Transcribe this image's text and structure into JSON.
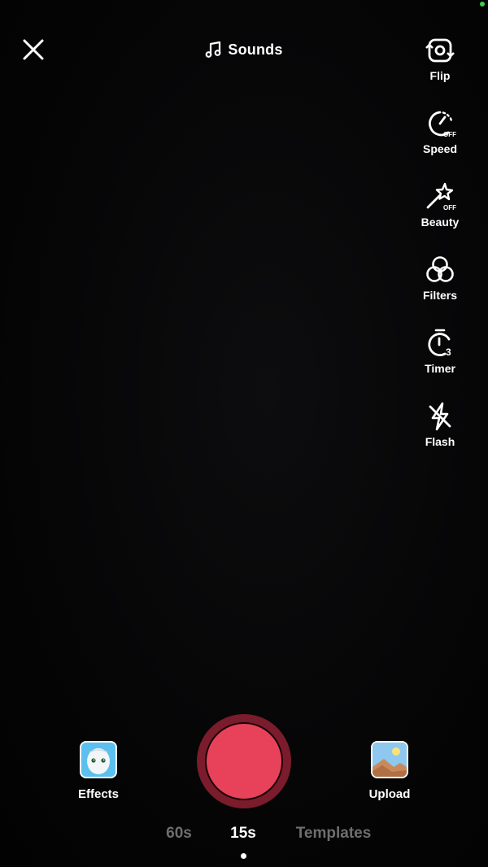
{
  "top_bar": {
    "sounds_label": "Sounds"
  },
  "side_tools": [
    {
      "id": "flip",
      "label": "Flip",
      "icon": "flip-camera-icon"
    },
    {
      "id": "speed",
      "label": "Speed",
      "icon": "speed-icon",
      "badge": "OFF"
    },
    {
      "id": "beauty",
      "label": "Beauty",
      "icon": "beauty-wand-icon",
      "badge": "OFF"
    },
    {
      "id": "filters",
      "label": "Filters",
      "icon": "filters-icon"
    },
    {
      "id": "timer",
      "label": "Timer",
      "icon": "timer-icon",
      "badge": "3"
    },
    {
      "id": "flash",
      "label": "Flash",
      "icon": "flash-off-icon"
    }
  ],
  "bottom": {
    "effects_label": "Effects",
    "upload_label": "Upload"
  },
  "modes": [
    {
      "label": "60s",
      "active": false
    },
    {
      "label": "15s",
      "active": true
    },
    {
      "label": "Templates",
      "active": false
    }
  ],
  "colors": {
    "record_outer": "#7a1c2b",
    "record_inner": "#e8425a",
    "status_dot": "#3ecf4a"
  }
}
